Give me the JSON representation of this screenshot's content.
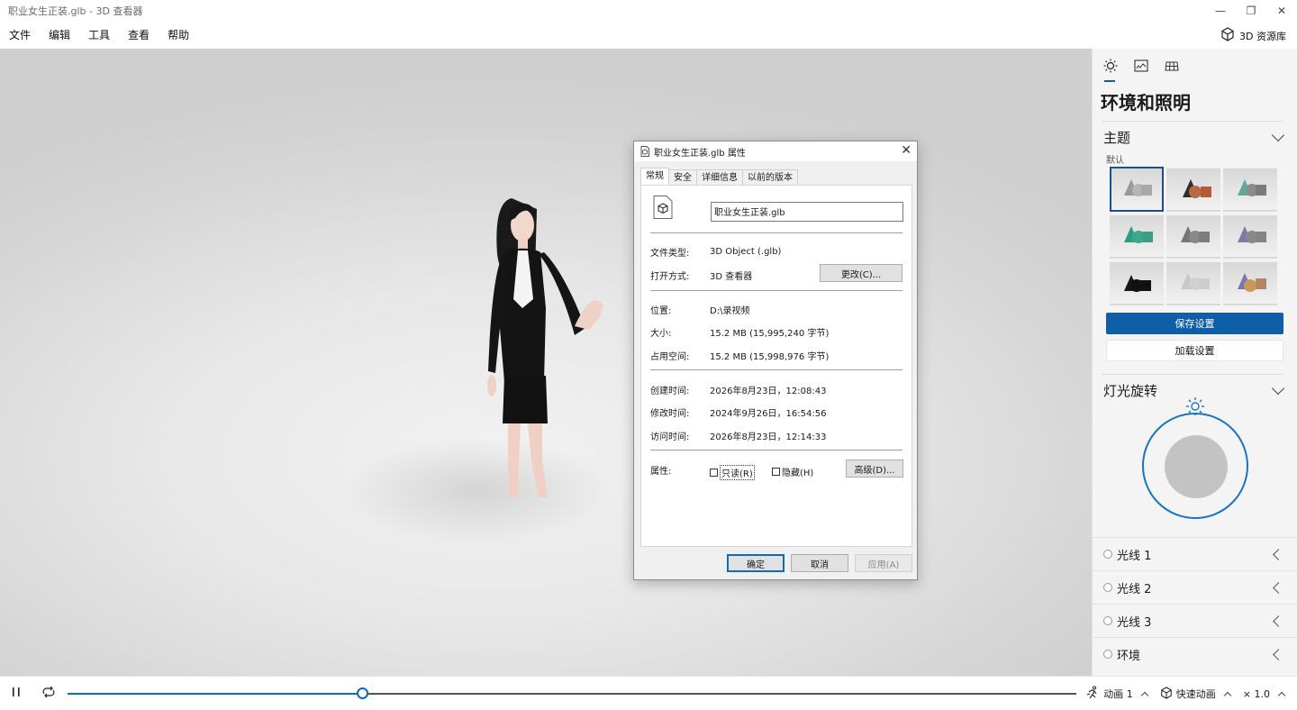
{
  "window": {
    "title": "职业女生正装.glb - 3D 查看器",
    "minimize": "—",
    "restore": "❐",
    "close": "✕"
  },
  "menu": {
    "items": [
      "文件",
      "编辑",
      "工具",
      "查看",
      "帮助"
    ],
    "library_label": "3D 资源库"
  },
  "panel": {
    "title": "环境和照明",
    "theme_section": "主题",
    "theme_sublabel": "默认",
    "save_label": "保存设置",
    "load_label": "加载设置",
    "rotation_section": "灯光旋转",
    "lights": [
      "光线 1",
      "光线 2",
      "光线 3",
      "环境"
    ],
    "accent": "#0f5ea8"
  },
  "bottom": {
    "progress": 0.292,
    "animation_label": "动画 1",
    "quick_anim_label": "快速动画",
    "speed_label": "× 1.0"
  },
  "dialog": {
    "title": "职业女生正装.glb 属性",
    "tabs": [
      "常规",
      "安全",
      "详细信息",
      "以前的版本"
    ],
    "filename": "职业女生正装.glb",
    "type_key": "文件类型:",
    "type_val": "3D Object (.glb)",
    "open_key": "打开方式:",
    "open_val": "3D 查看器",
    "change_btn": "更改(C)...",
    "location_key": "位置:",
    "location_val": "D:\\录视频",
    "size_key": "大小:",
    "size_val": "15.2 MB (15,995,240 字节)",
    "disk_key": "占用空间:",
    "disk_val": "15.2 MB (15,998,976 字节)",
    "created_key": "创建时间:",
    "created_val": "2026年8月23日，12:08:43",
    "modified_key": "修改时间:",
    "modified_val": "2024年9月26日，16:54:56",
    "accessed_key": "访问时间:",
    "accessed_val": "2026年8月23日，12:14:33",
    "attr_key": "属性:",
    "readonly_label": "只读(R)",
    "hidden_label": "隐藏(H)",
    "advanced_btn": "高级(D)...",
    "ok": "确定",
    "cancel": "取消",
    "apply": "应用(A)",
    "close": "✕"
  }
}
